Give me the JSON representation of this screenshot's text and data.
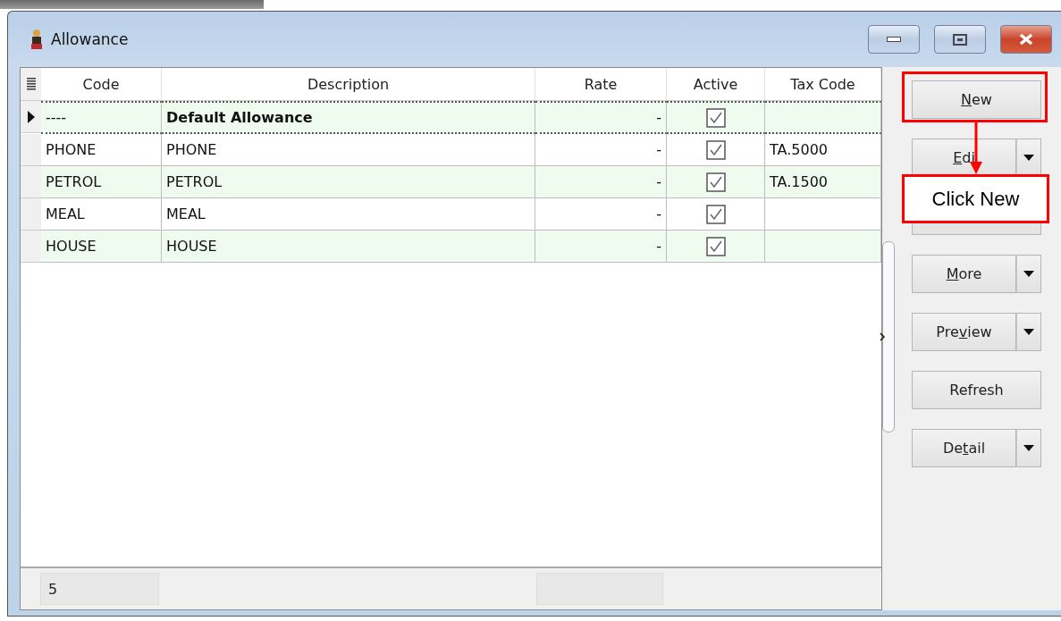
{
  "window": {
    "title": "Allowance"
  },
  "table": {
    "columns": [
      "Code",
      "Description",
      "Rate",
      "Active",
      "Tax Code"
    ],
    "rows": [
      {
        "code": "----",
        "description": "Default Allowance",
        "rate": "-",
        "active": true,
        "tax_code": "",
        "selected": true,
        "bold": true
      },
      {
        "code": "PHONE",
        "description": "PHONE",
        "rate": "-",
        "active": true,
        "tax_code": "TA.5000",
        "selected": false,
        "bold": false
      },
      {
        "code": "PETROL",
        "description": "PETROL",
        "rate": "-",
        "active": true,
        "tax_code": "TA.1500",
        "selected": false,
        "bold": false
      },
      {
        "code": "MEAL",
        "description": "MEAL",
        "rate": "-",
        "active": true,
        "tax_code": "",
        "selected": false,
        "bold": false
      },
      {
        "code": "HOUSE",
        "description": "HOUSE",
        "rate": "-",
        "active": true,
        "tax_code": "",
        "selected": false,
        "bold": false
      }
    ],
    "footer": {
      "count": "5"
    }
  },
  "buttons": [
    {
      "key": "N",
      "after": "ew",
      "dropdown": false
    },
    {
      "key": "E",
      "after": "di",
      "dropdown": true
    },
    {
      "dropdown": false
    },
    {
      "key": "M",
      "after": "ore",
      "dropdown": true
    },
    {
      "before": "Pre",
      "key": "v",
      "after": "iew",
      "dropdown": true
    },
    {
      "before": "Refresh",
      "dropdown": false
    },
    {
      "before": "De",
      "key": "t",
      "after": "ail",
      "dropdown": true
    }
  ],
  "callout": {
    "text": "Click New"
  }
}
